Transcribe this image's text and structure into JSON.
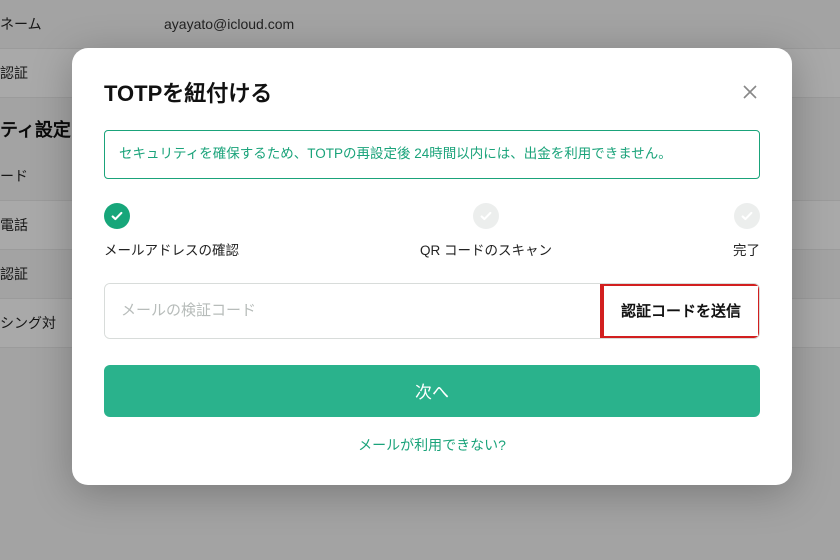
{
  "background": {
    "username_label": "ネーム",
    "username_value": "ayayato@icloud.com",
    "row_auth": "認証",
    "section_title": "ティ設定",
    "row_password": "ード",
    "row_phone": "電話",
    "row_mfa": "認証",
    "row_phishing": "シング対"
  },
  "modal": {
    "title": "TOTPを紐付ける",
    "notice": "セキュリティを確保するため、TOTPの再設定後 24時間以内には、出金を利用できません。",
    "steps": {
      "s1": "メールアドレスの確認",
      "s2": "QR コードのスキャン",
      "s3": "完了"
    },
    "input_placeholder": "メールの検証コード",
    "send_code_label": "認証コードを送信",
    "next_label": "次へ",
    "alt_link": "メールが利用できない?"
  }
}
